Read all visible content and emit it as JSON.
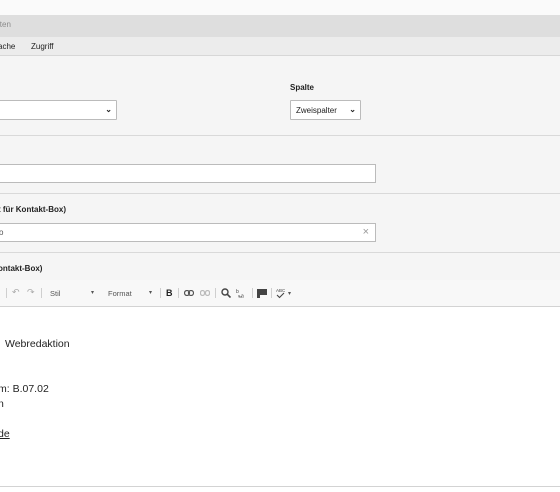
{
  "header": {
    "title": "iten"
  },
  "tabs": [
    {
      "label": "ache"
    },
    {
      "label": "Zugriff"
    }
  ],
  "layout_section": {
    "select_value": "",
    "spalte_label": "Spalte",
    "spalte_value": "Zweispalter"
  },
  "field_section_1": {
    "value": ""
  },
  "field_section_2": {
    "label": "t für Kontakt-Box)",
    "value": "o",
    "clear_icon": "×"
  },
  "rte_section": {
    "label": "ontakt-Box)"
  },
  "toolbar": {
    "undo_icon": "↶",
    "redo_icon": "↷",
    "style_label": "Stil",
    "format_label": "Format",
    "bold_label": "B",
    "link_icon": "link",
    "unlink_icon": "unlink",
    "find_icon": "search",
    "replace_icon": "replace",
    "blockquote_icon": "blockquote",
    "spellcheck_label": "ABC",
    "dropdown_arrow": "▾"
  },
  "editor": {
    "line1": "Webredaktion",
    "line2": "m: B.07.02",
    "line3": "n",
    "link": "de"
  }
}
